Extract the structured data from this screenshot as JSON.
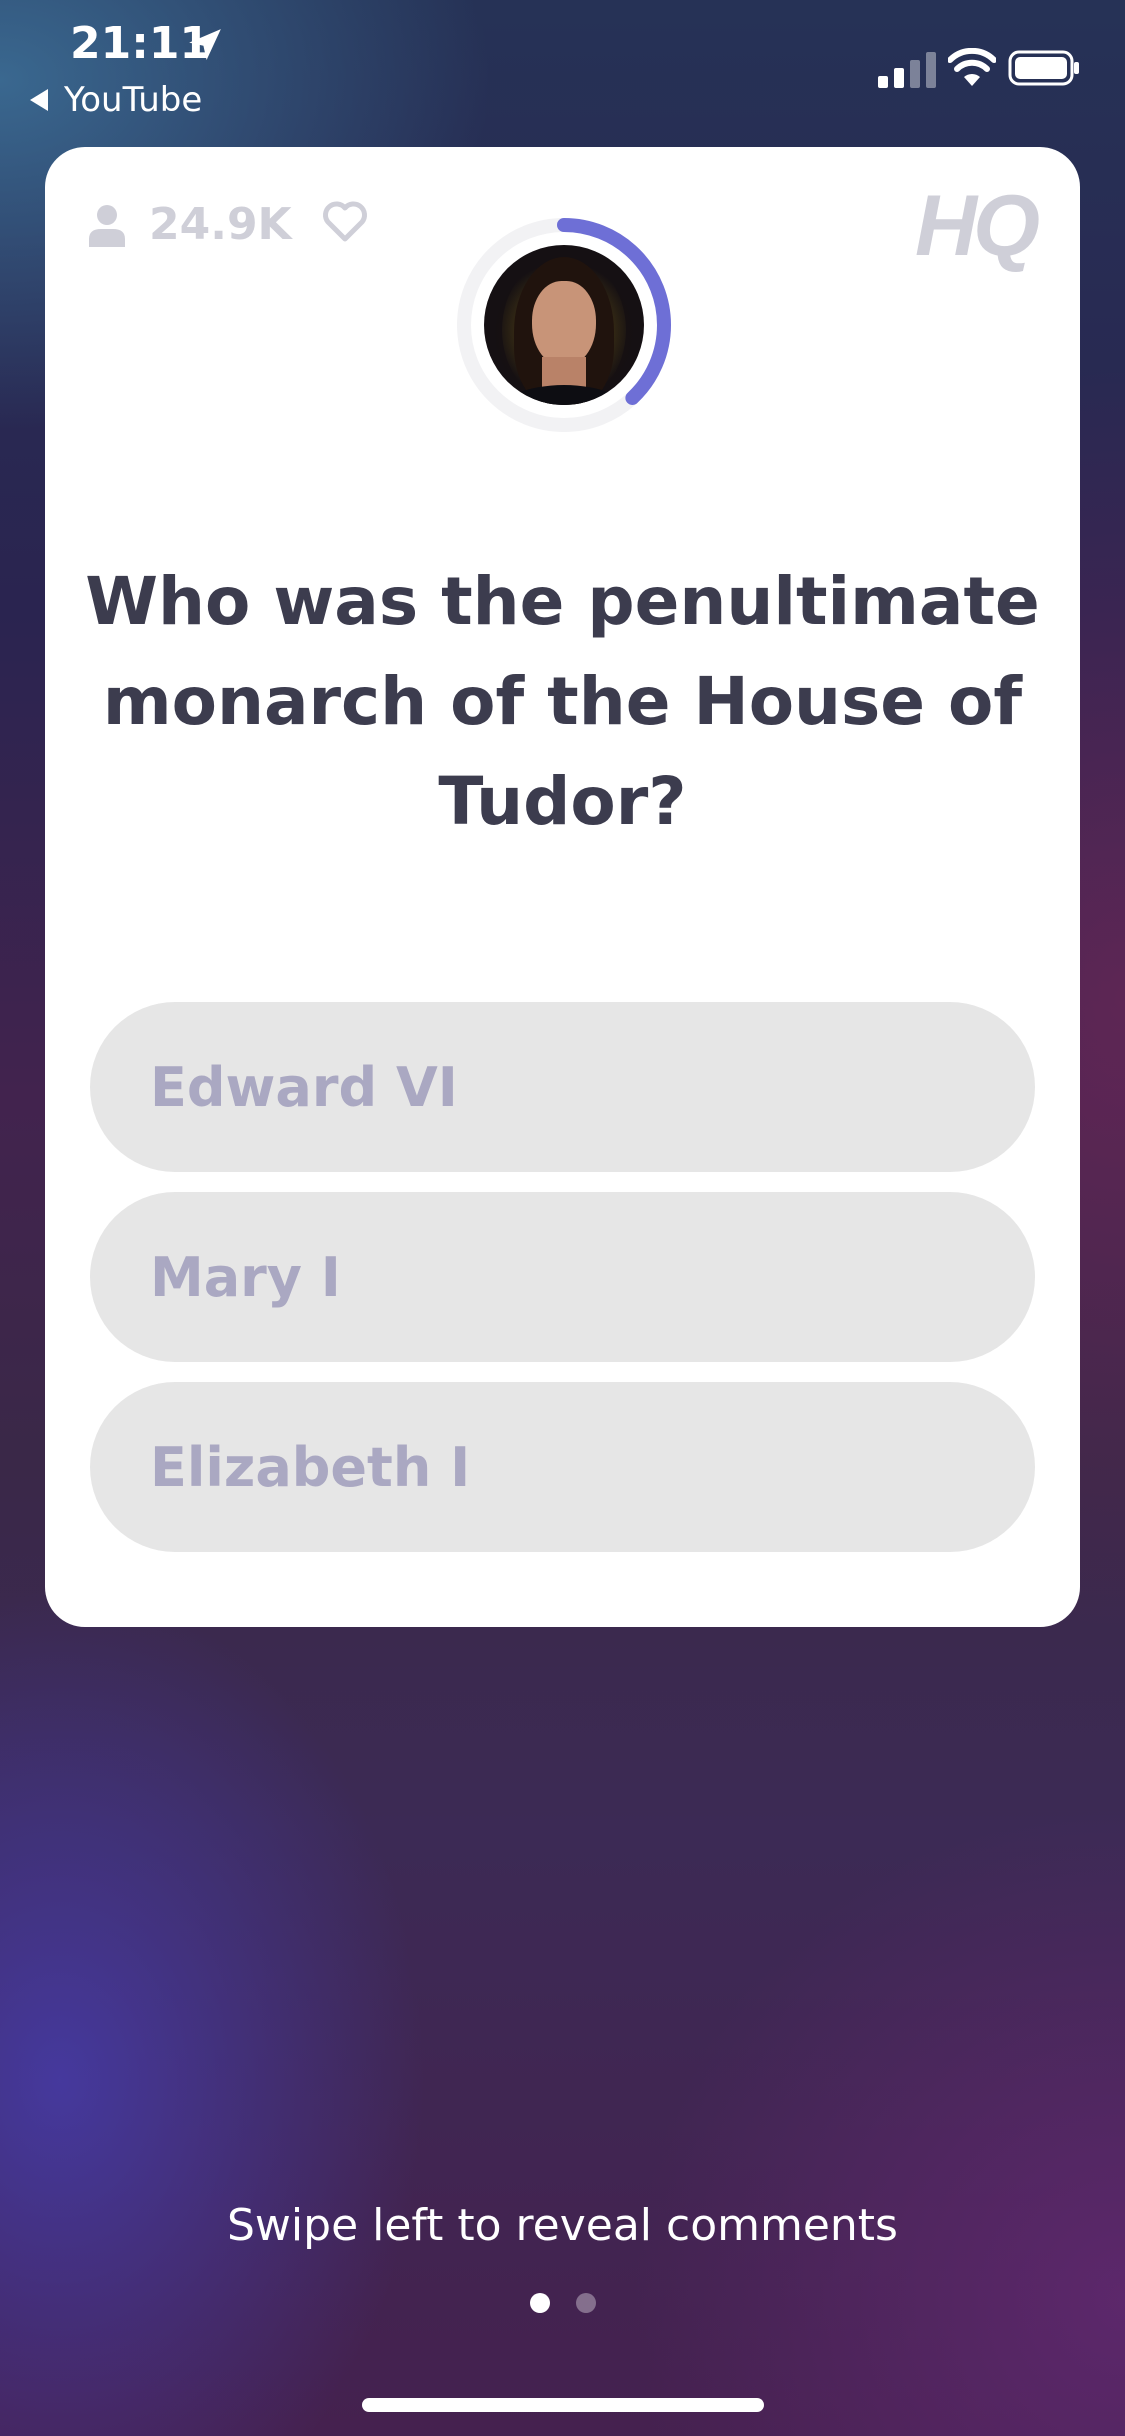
{
  "status_bar": {
    "time": "21:11",
    "back_app": "YouTube"
  },
  "card": {
    "viewer_count": "24.9K",
    "logo": "HQ",
    "timer_progress": 0.38,
    "question": "Who was the penultimate monarch of the House of Tudor?",
    "answers": [
      {
        "label": "Edward VI"
      },
      {
        "label": "Mary I"
      },
      {
        "label": "Elizabeth I"
      }
    ]
  },
  "footer": {
    "hint": "Swipe left to reveal comments",
    "page_count": 2,
    "active_page": 1
  },
  "colors": {
    "timer_ring": "#6e6fd6",
    "answer_bg": "#e6e6e6",
    "answer_text": "#aaa8c2",
    "question_text": "#3c3c4e"
  },
  "icons": [
    "location-arrow-icon",
    "back-triangle-icon",
    "cellular-signal-icon",
    "wifi-icon",
    "battery-icon",
    "person-icon",
    "heart-icon"
  ]
}
